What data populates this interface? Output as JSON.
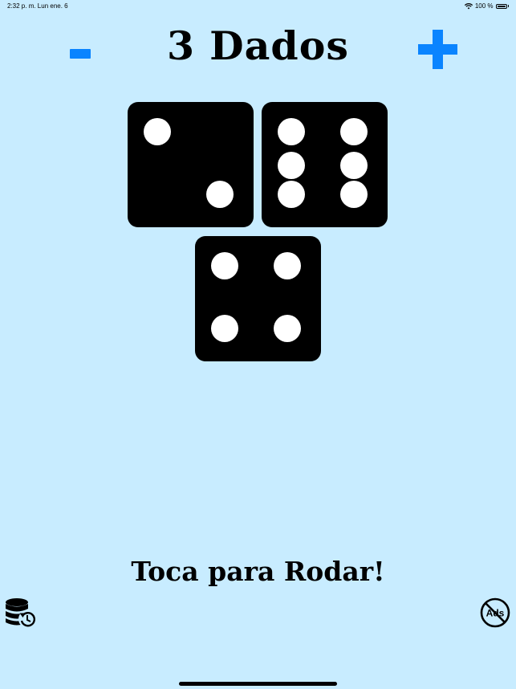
{
  "status_bar": {
    "time_date": "2:32 p. m.   Lun ene. 6",
    "battery_text": "100 %"
  },
  "header": {
    "title": "3 Dados",
    "minus_label": "-",
    "plus_label": "+"
  },
  "dice": [
    {
      "value": 2
    },
    {
      "value": 6
    },
    {
      "value": 4
    }
  ],
  "prompt": {
    "text": "Toca para Rodar!"
  },
  "bottom_bar": {
    "history_icon": "database-history-icon",
    "noads_icon": "no-ads-icon",
    "noads_text": "Ads"
  },
  "colors": {
    "background": "#c8ecff",
    "accent": "#0a84ff",
    "die": "#000000",
    "pip": "#ffffff"
  }
}
